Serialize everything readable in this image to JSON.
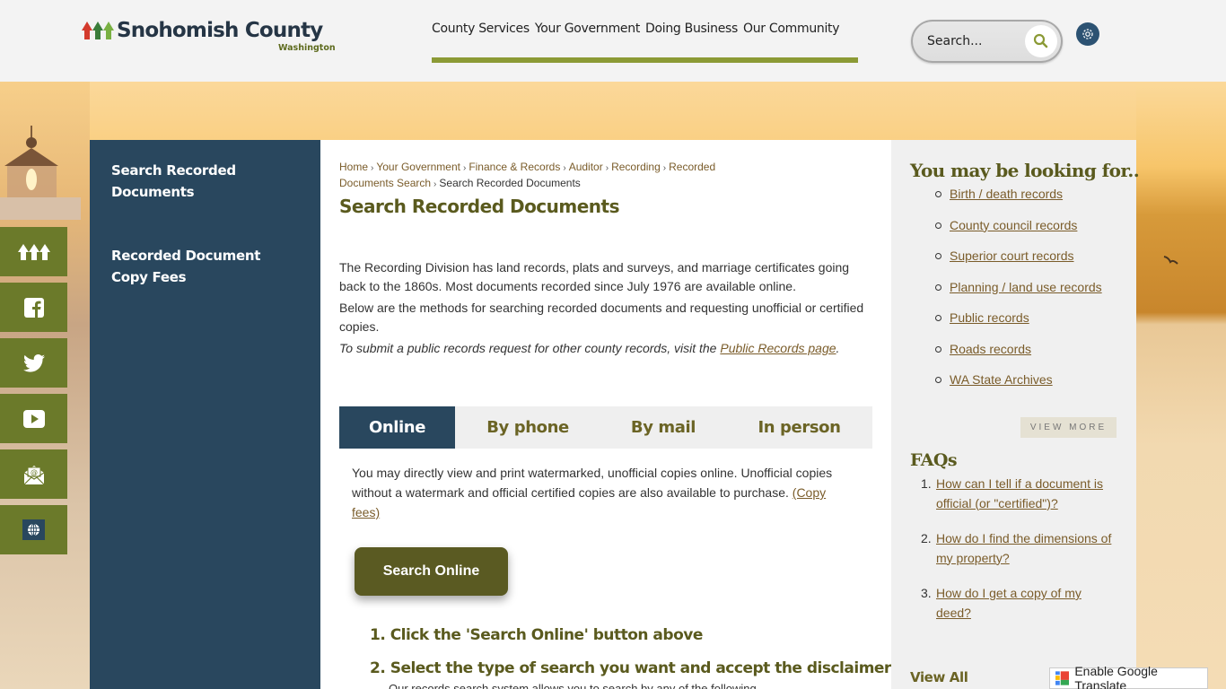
{
  "header": {
    "logo": {
      "name": "Snohomish County",
      "subtitle": "Washington"
    },
    "nav": [
      {
        "label": "County Services"
      },
      {
        "label": "Your Government"
      },
      {
        "label": "Doing Business"
      },
      {
        "label": "Our Community"
      }
    ],
    "search": {
      "placeholder": "Search...",
      "icon": "search-icon"
    },
    "settings_icon": "gear-icon",
    "accent_color": "#8b9a35"
  },
  "social": [
    {
      "name": "snohomish-county-home",
      "icon": "county-logo-icon"
    },
    {
      "name": "facebook",
      "icon": "facebook-icon"
    },
    {
      "name": "twitter",
      "icon": "twitter-icon"
    },
    {
      "name": "youtube",
      "icon": "youtube-icon"
    },
    {
      "name": "email",
      "icon": "email-icon"
    },
    {
      "name": "language",
      "icon": "globe-icon"
    }
  ],
  "leftnav": {
    "items": [
      {
        "label": "Search Recorded Documents"
      },
      {
        "label": "Recorded Document Copy Fees"
      }
    ]
  },
  "breadcrumb": {
    "items": [
      {
        "label": "Home"
      },
      {
        "label": "Your Government"
      },
      {
        "label": "Finance & Records"
      },
      {
        "label": "Auditor"
      },
      {
        "label": "Recording"
      },
      {
        "label": "Recorded Documents Search"
      }
    ],
    "current": "Search Recorded Documents"
  },
  "main": {
    "title": "Search Recorded Documents",
    "intro": [
      "The Recording Division has land records, plats and surveys, and marriage certificates going back to the 1860s. Most documents recorded since July 1976 are available online.",
      "Below are the methods for searching recorded documents and requesting unofficial or certified copies."
    ],
    "records_note": "To submit a public records request for other county records, visit the ",
    "records_link": "Public Records page",
    "records_end": ".",
    "tabs": [
      {
        "label": "Online",
        "active": true
      },
      {
        "label": "By phone",
        "active": false
      },
      {
        "label": "By mail",
        "active": false
      },
      {
        "label": "In person",
        "active": false
      }
    ],
    "online_text": "You may directly view and print watermarked, unofficial copies online. Unofficial copies without a watermark and official certified copies are also available to purchase. ",
    "online_link": "(Copy fees)",
    "search_button": "Search Online",
    "steps": [
      "1. Click the 'Search Online' button above",
      "2. Select the type of search you want and accept the disclaimer"
    ],
    "step_sub": "Our records search system allows you to search by any of the following"
  },
  "rightbar": {
    "looking_title": "You may be looking for..",
    "links": [
      "Birth / death records",
      "County council records",
      "Superior court records",
      "Planning / land use records",
      "Public records",
      "Roads records",
      "WA State Archives"
    ],
    "view_more": "VIEW MORE",
    "faq_title": "FAQs",
    "faqs": [
      {
        "num": "1.",
        "q": "How can I tell if a document is official (or \"certified\")?"
      },
      {
        "num": "2.",
        "q": "How do I find the dimensions of my property?"
      },
      {
        "num": "3.",
        "q": "How do I get a copy of my deed?"
      }
    ],
    "view_all": "View All"
  },
  "translate": {
    "label": "Enable Google Translate"
  }
}
